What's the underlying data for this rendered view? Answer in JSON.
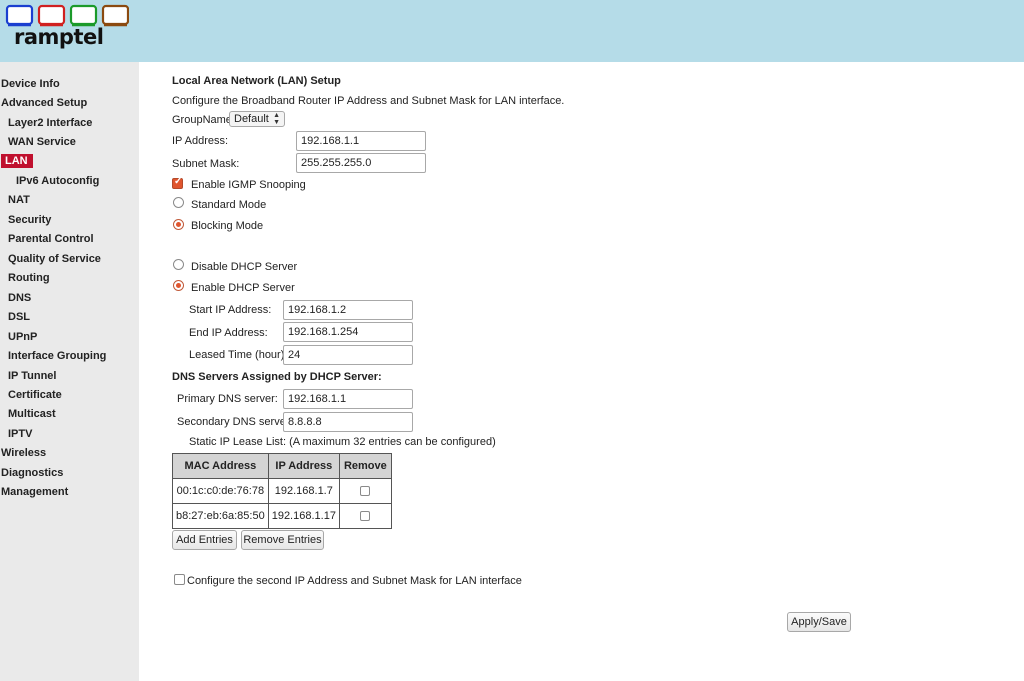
{
  "brand": {
    "logo_text": "ramptel",
    "square_colors": [
      "#1a3fd0",
      "#d02020",
      "#1b9a2a",
      "#8b4a10"
    ]
  },
  "sidebar": {
    "items": [
      {
        "label": "Device Info"
      },
      {
        "label": "Advanced Setup"
      },
      {
        "label": "Layer2 Interface"
      },
      {
        "label": "WAN Service"
      },
      {
        "label": "LAN"
      },
      {
        "label": "IPv6 Autoconfig"
      },
      {
        "label": "NAT"
      },
      {
        "label": "Security"
      },
      {
        "label": "Parental Control"
      },
      {
        "label": "Quality of Service"
      },
      {
        "label": "Routing"
      },
      {
        "label": "DNS"
      },
      {
        "label": "DSL"
      },
      {
        "label": "UPnP"
      },
      {
        "label": "Interface Grouping"
      },
      {
        "label": "IP Tunnel"
      },
      {
        "label": "Certificate"
      },
      {
        "label": "Multicast"
      },
      {
        "label": "IPTV"
      },
      {
        "label": "Wireless"
      },
      {
        "label": "Diagnostics"
      },
      {
        "label": "Management"
      }
    ],
    "active_color": "#c0102e"
  },
  "main": {
    "title": "Local Area Network (LAN) Setup",
    "description": "Configure the Broadband Router IP Address and Subnet Mask for LAN interface.",
    "group_name_label": "GroupName",
    "group_name_value": "Default",
    "ip_address_label": "IP Address:",
    "ip_address_value": "192.168.1.1",
    "subnet_mask_label": "Subnet Mask:",
    "subnet_mask_value": "255.255.255.0",
    "igmp_label": "Enable IGMP Snooping",
    "igmp_checked": true,
    "standard_mode_label": "Standard Mode",
    "blocking_mode_label": "Blocking Mode",
    "blocking_mode_selected": true,
    "disable_dhcp_label": "Disable DHCP Server",
    "enable_dhcp_label": "Enable DHCP Server",
    "enable_dhcp_selected": true,
    "start_ip_label": "Start IP Address:",
    "start_ip_value": "192.168.1.2",
    "end_ip_label": "End IP Address:",
    "end_ip_value": "192.168.1.254",
    "lease_time_label": "Leased Time (hour):",
    "lease_time_value": "24",
    "dns_heading": "DNS Servers Assigned by DHCP Server:",
    "primary_dns_label": "Primary DNS server:",
    "primary_dns_value": "192.168.1.1",
    "secondary_dns_label": "Secondary DNS server:",
    "secondary_dns_value": "8.8.8.8",
    "static_lease_label": "Static IP Lease List: (A maximum 32 entries can be configured)",
    "table": {
      "headers": [
        "MAC Address",
        "IP Address",
        "Remove"
      ],
      "rows": [
        {
          "mac": "00:1c:c0:de:76:78",
          "ip": "192.168.1.7"
        },
        {
          "mac": "b8:27:eb:6a:85:50",
          "ip": "192.168.1.17"
        }
      ]
    },
    "add_entries_label": "Add Entries",
    "remove_entries_label": "Remove Entries",
    "second_ip_label": "Configure the second IP Address and Subnet Mask for LAN interface",
    "apply_label": "Apply/Save",
    "accent": "#e0552e"
  }
}
